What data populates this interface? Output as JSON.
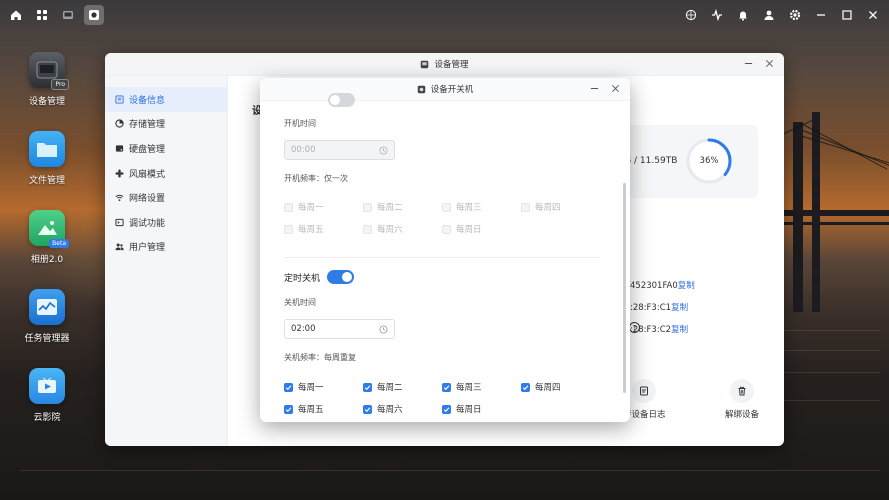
{
  "desktop_icons": [
    {
      "label": "设备管理",
      "badge": "Pro"
    },
    {
      "label": "文件管理"
    },
    {
      "label": "相册2.0",
      "badge": "Beta"
    },
    {
      "label": "任务管理器"
    },
    {
      "label": "云影院"
    }
  ],
  "main_window": {
    "title": "设备管理",
    "content_heading": "设",
    "sidebar": [
      {
        "label": "设备信息",
        "icon": "list-icon",
        "active": true
      },
      {
        "label": "存储管理",
        "icon": "pie-chart-icon"
      },
      {
        "label": "硬盘管理",
        "icon": "disk-icon"
      },
      {
        "label": "风扇模式",
        "icon": "fan-icon"
      },
      {
        "label": "网络设置",
        "icon": "wifi-icon"
      },
      {
        "label": "调试功能",
        "icon": "debug-icon"
      },
      {
        "label": "用户管理",
        "icon": "users-icon"
      }
    ],
    "storage_text": "B / 11.59TB",
    "storage_percent": "36%",
    "storage_fraction": 0.36,
    "mac_rows": [
      {
        "value": "452301FA0",
        "copy": "复制"
      },
      {
        "value": ":28:F3:C1",
        "copy": "复制"
      },
      {
        "value": ":28:F3:C2",
        "copy": "复制"
      }
    ],
    "help_glyph": "?",
    "actions": [
      {
        "label": "传设备日志",
        "icon": "log-icon"
      },
      {
        "label": "解绑设备",
        "icon": "trash-icon"
      }
    ]
  },
  "dialog": {
    "title": "设备开关机",
    "power_on": {
      "time_label": "开机时间",
      "time_value": "00:00",
      "frequency_label": "开机频率：仅一次",
      "days": [
        "每周一",
        "每周二",
        "每周三",
        "每周四",
        "每周五",
        "每周六",
        "每周日"
      ]
    },
    "power_off": {
      "toggle_label": "定时关机",
      "enabled": true,
      "time_label": "关机时间",
      "time_value": "02:00",
      "frequency_label": "关机频率：每周重复",
      "days": [
        "每周一",
        "每周二",
        "每周三",
        "每周四",
        "每周五",
        "每周六",
        "每周日"
      ]
    }
  },
  "colors": {
    "accent": "#2f7ce8",
    "toggle_off": "#d4d7dc"
  }
}
